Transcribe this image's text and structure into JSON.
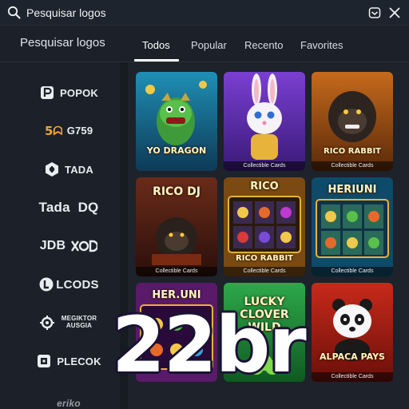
{
  "search": {
    "placeholder": "Pesquisar logos"
  },
  "sidebar": {
    "title": "Pesquisar logos",
    "providers": [
      {
        "label": "POPOK",
        "icon": "popok-logo-icon"
      },
      {
        "label": "G759",
        "icon": "g759-logo-icon"
      },
      {
        "label": "TADA",
        "icon": "tada-logo-icon"
      },
      {
        "label": "Tada  DQ",
        "icon": ""
      },
      {
        "label": "JDB",
        "icon": "jdb-logo-icon"
      },
      {
        "label": "LCODS",
        "icon": "lcods-logo-icon"
      },
      {
        "label": "MEGIKTOR AUSGIA",
        "icon": "megiktor-logo-icon"
      },
      {
        "label": "PLECOK",
        "icon": "plecok-logo-icon"
      },
      {
        "label": "eriko",
        "icon": ""
      }
    ]
  },
  "tabs": [
    {
      "label": "Todos",
      "active": true
    },
    {
      "label": "Popular",
      "active": false
    },
    {
      "label": "Recento",
      "active": false
    },
    {
      "label": "Favorites",
      "active": false
    }
  ],
  "games": [
    {
      "title": "YO DRAGON",
      "caption": ""
    },
    {
      "title": "",
      "caption": "Collectible Cards"
    },
    {
      "title": "RICO RABBIT",
      "caption": "Collectible Cards"
    },
    {
      "title": "RICO DJ",
      "caption": "Collectible Cards"
    },
    {
      "title": "RICO RABBIT",
      "caption": "Collectible Cards"
    },
    {
      "title": "HERIUNI",
      "caption": "Collectible Cards"
    },
    {
      "title": "HER.UNI",
      "caption": ""
    },
    {
      "title": "LUCKY CLOVER WILD",
      "caption": ""
    },
    {
      "title": "ALPACA PAYS",
      "caption": "Collectible Cards"
    }
  ],
  "overlay": {
    "text": "22br"
  },
  "colors": {
    "background": "#1b2029",
    "accent": "#ffffff"
  }
}
